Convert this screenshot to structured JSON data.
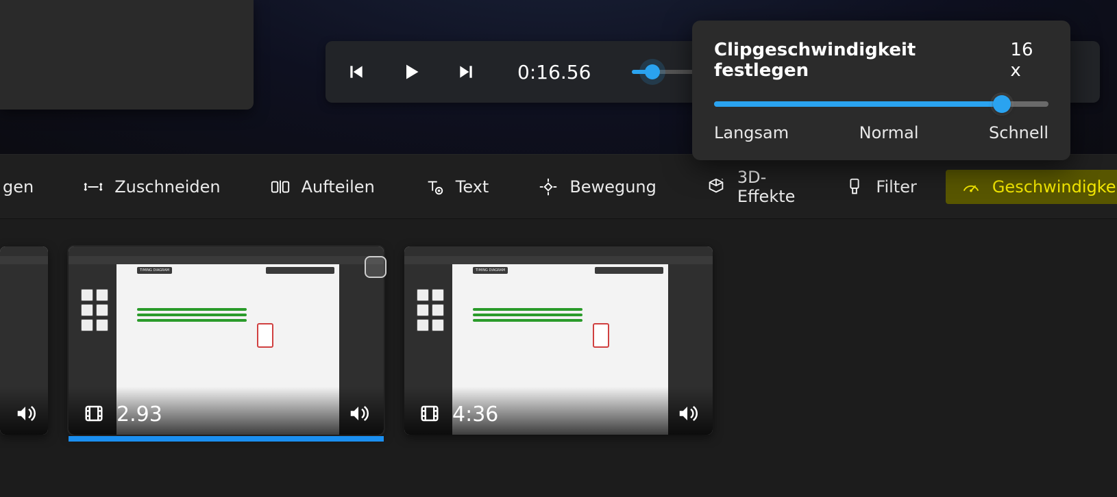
{
  "playback": {
    "time": "0:16.56",
    "mini_slider_pct": 25
  },
  "speed_popup": {
    "title": "Clipgeschwindigkeit festlegen",
    "value": "16 x",
    "slow": "Langsam",
    "normal": "Normal",
    "fast": "Schnell",
    "slider_pct": 86
  },
  "toolbar": {
    "partial_item": "gen",
    "trim": "Zuschneiden",
    "split": "Aufteilen",
    "text": "Text",
    "motion": "Bewegung",
    "effects3d": "3D-Effekte",
    "filter": "Filter",
    "speed": "Geschwindigkeit"
  },
  "clips": [
    {
      "duration": "2.93",
      "selected": true
    },
    {
      "duration": "4:36",
      "selected": false
    }
  ]
}
